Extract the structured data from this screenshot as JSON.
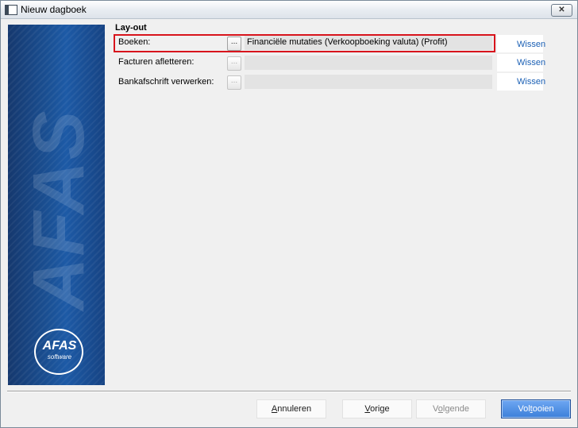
{
  "window": {
    "title": "Nieuw dagboek",
    "close_glyph": "✕"
  },
  "side_panel": {
    "watermark": "AFAS",
    "logo_main": "AFAS",
    "logo_sub": "software"
  },
  "section": {
    "title": "Lay-out"
  },
  "rows": [
    {
      "label": "Boeken:",
      "browse": "...",
      "value": "Financiële mutaties (Verkoopboeking valuta) (Profit)",
      "clear": "Wissen"
    },
    {
      "label": "Facturen afletteren:",
      "browse": "...",
      "value": "",
      "clear": "Wissen"
    },
    {
      "label": "Bankafschrift verwerken:",
      "browse": "...",
      "value": "",
      "clear": "Wissen"
    }
  ],
  "footer": {
    "cancel": {
      "pre": "",
      "key": "A",
      "post": "nnuleren"
    },
    "previous": {
      "pre": "",
      "key": "V",
      "post": "orige"
    },
    "next": {
      "pre": "V",
      "key": "o",
      "post": "lgende"
    },
    "finish": {
      "pre": "Vol",
      "key": "t",
      "post": "ooien"
    }
  },
  "colors": {
    "highlight": "#d8141c",
    "link": "#1a5fb4",
    "primary_button": "#3c7fd9",
    "brand_panel": "#1d5aa6"
  }
}
